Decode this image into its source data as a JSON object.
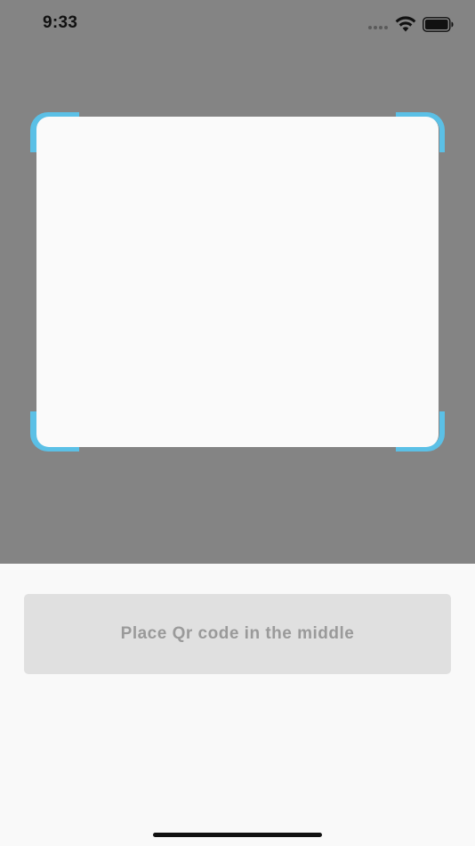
{
  "status_bar": {
    "time": "9:33"
  },
  "scanner": {
    "frame_color": "#5bc0e6",
    "overlay_color": "#848484"
  },
  "instruction": {
    "label": "Place Qr code in the middle"
  },
  "icons": {
    "signal": "cellular-signal-icon",
    "wifi": "wifi-icon",
    "battery": "battery-icon"
  }
}
